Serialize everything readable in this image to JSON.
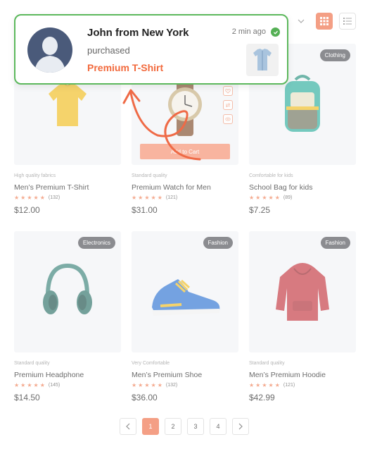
{
  "toolbar": {
    "sort_icon": "chevron-down-icon",
    "grid_icon": "grid-view-icon",
    "list_icon": "list-view-icon",
    "accent": "#f07a57"
  },
  "products": [
    {
      "badge": "",
      "quality": "High quality fabrics",
      "name": "Men’s Premium T-Shirt",
      "stars": 5,
      "reviews": "(132)",
      "price": "$12.00",
      "image": "t-shirt-image"
    },
    {
      "badge": "",
      "quality": "Standard quality",
      "name": "Premium Watch for Men",
      "stars": 5,
      "reviews": "(121)",
      "price": "$31.00",
      "image": "watch-image",
      "hover_action": "Add to Cart"
    },
    {
      "badge": "Clothing",
      "quality": "Comfortable for kids",
      "name": "School Bag for kids",
      "stars": 5,
      "reviews": "(89)",
      "price": "$7.25",
      "image": "backpack-image"
    },
    {
      "badge": "Electronics",
      "quality": "Standard quality",
      "name": "Premium Headphone",
      "stars": 5,
      "reviews": "(145)",
      "price": "$14.50",
      "image": "headphone-image"
    },
    {
      "badge": "Fashion",
      "quality": "Very Comfortable",
      "name": "Men’s Premium Shoe",
      "stars": 5,
      "reviews": "(132)",
      "price": "$36.00",
      "image": "shoe-image"
    },
    {
      "badge": "Fashion",
      "quality": "Standard quality",
      "name": "Men’s Premium Hoodie",
      "stars": 5,
      "reviews": "(121)",
      "price": "$42.99",
      "image": "hoodie-image"
    }
  ],
  "pagination": {
    "pages": [
      "1",
      "2",
      "3",
      "4"
    ],
    "current": "1"
  },
  "notification": {
    "name": "John from New York",
    "action": "purchased",
    "product": "Premium T-Shirt",
    "time": "2 min ago",
    "border_color": "#5cb85c",
    "product_color": "#f26a3d"
  }
}
